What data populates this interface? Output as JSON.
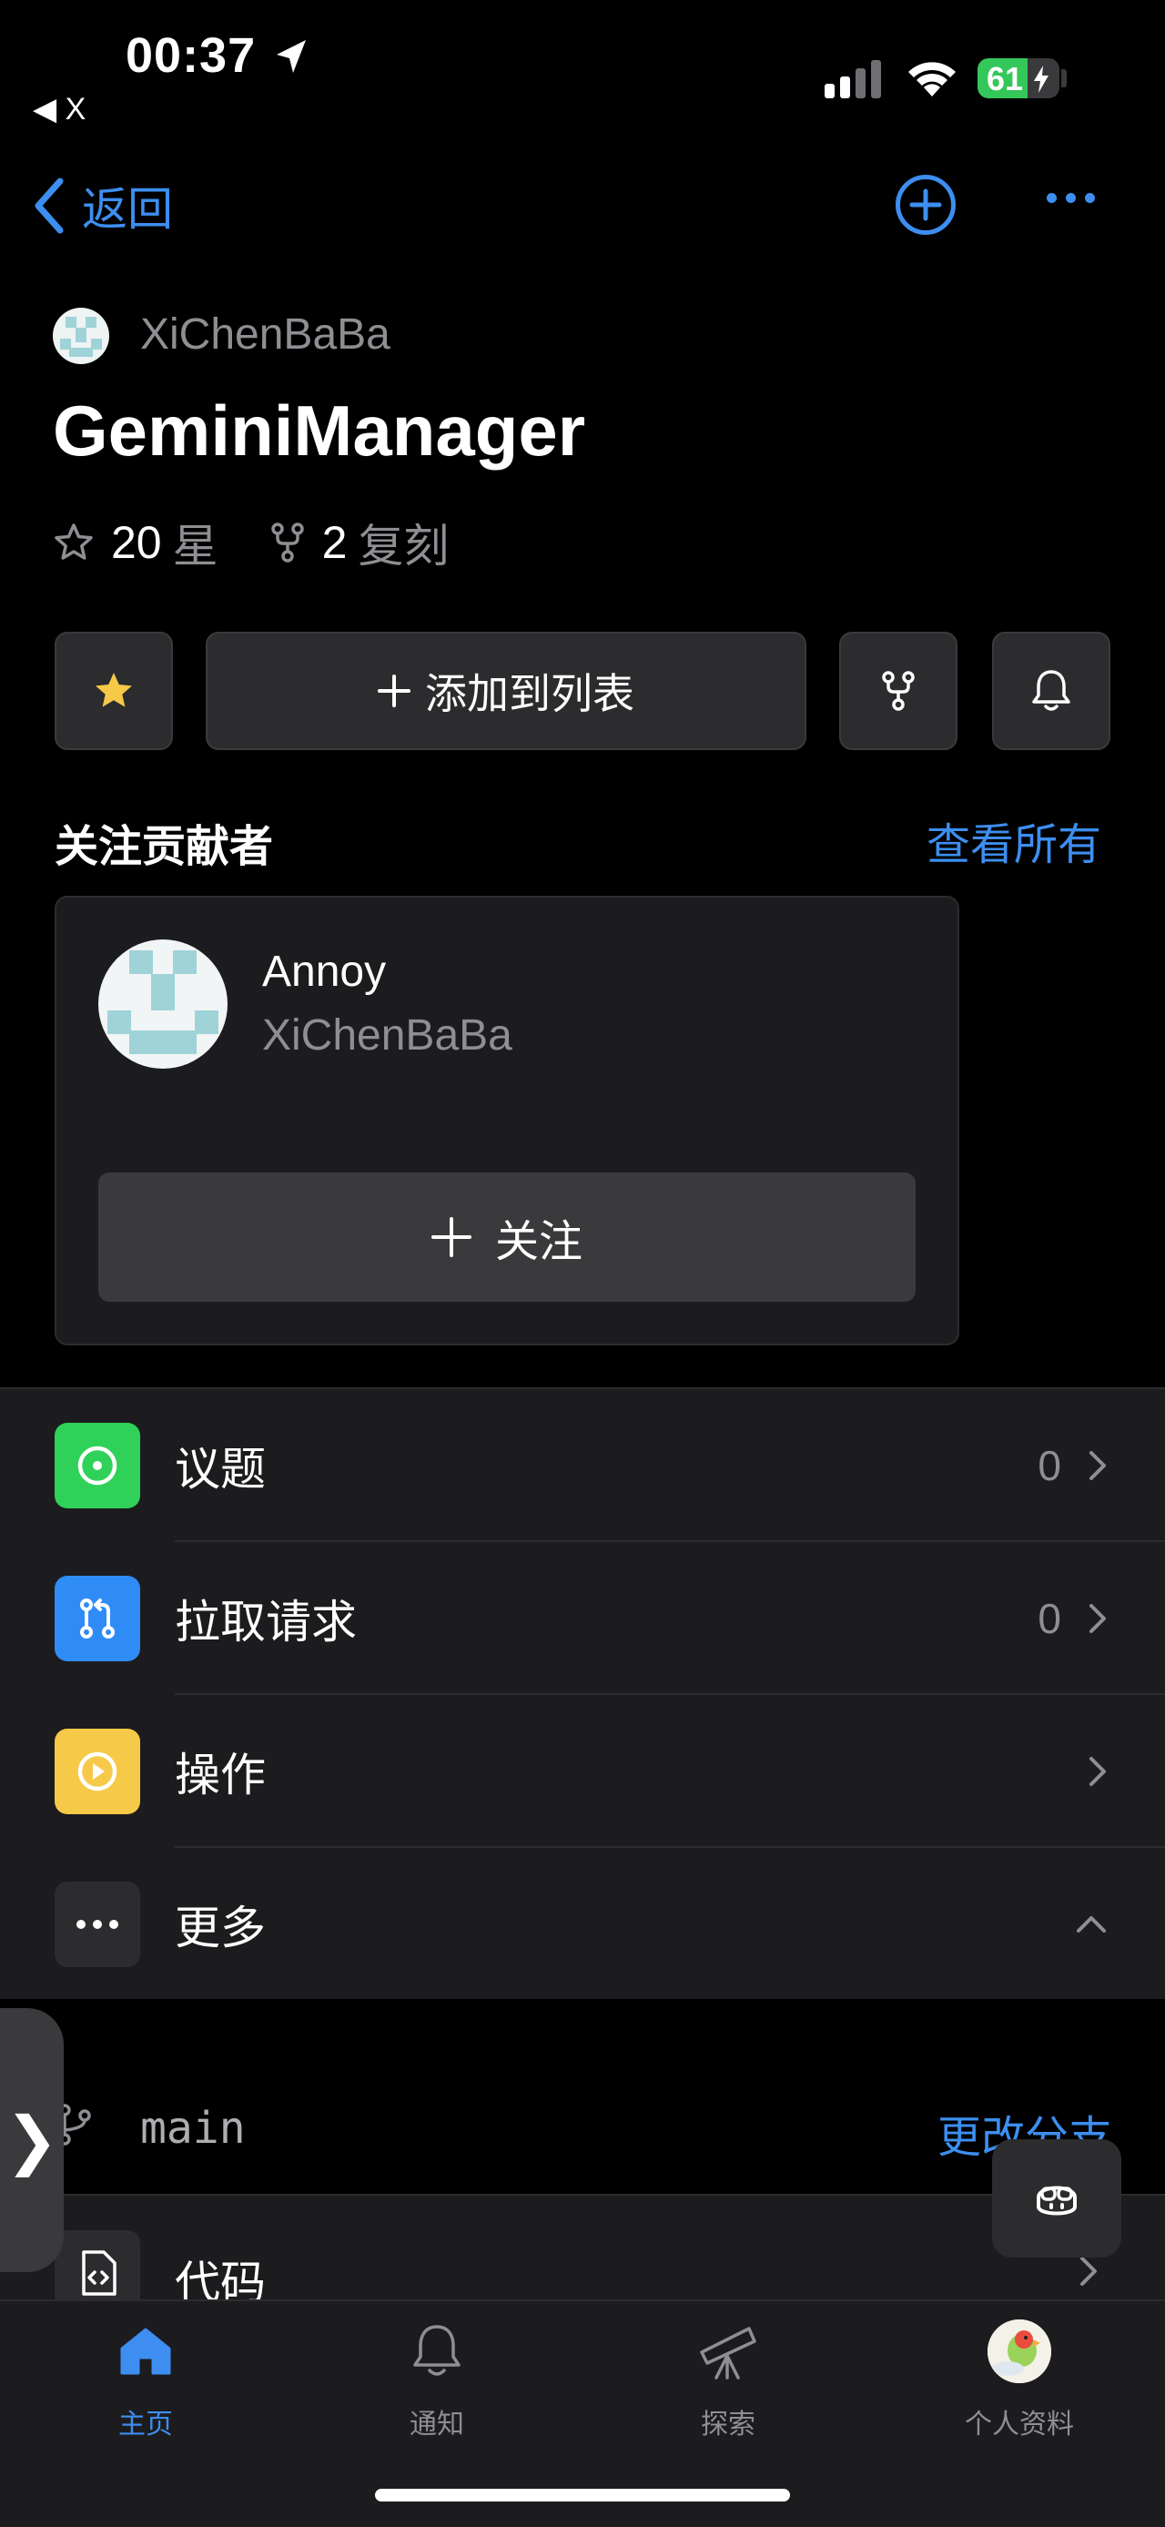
{
  "status_bar": {
    "time": "00:37",
    "back_app": "◀ X",
    "battery": {
      "level": 61,
      "label": "61"
    }
  },
  "nav": {
    "back_label": "返回"
  },
  "repo": {
    "owner": "XiChenBaBa",
    "name": "GeminiManager",
    "stars": {
      "count": "20",
      "label": "星"
    },
    "forks": {
      "count": "2",
      "label": "复刻"
    }
  },
  "actions": {
    "add_to_list": "添加到列表"
  },
  "contributors": {
    "title": "关注贡献者",
    "view_all": "查看所有",
    "card": {
      "name": "Annoy",
      "login": "XiChenBaBa",
      "follow_label": "关注"
    }
  },
  "menu": [
    {
      "label": "议题",
      "count": "0",
      "color": "#30d158"
    },
    {
      "label": "拉取请求",
      "count": "0",
      "color": "#2f8cf6"
    },
    {
      "label": "操作",
      "count": "",
      "color": "#f7c948"
    },
    {
      "label": "更多",
      "count": "",
      "color": "#2c2c2e"
    }
  ],
  "branch": {
    "name": "main",
    "change_label": "更改分支"
  },
  "code_row": {
    "label": "代码"
  },
  "side_handle": {
    "glyph": "❯"
  },
  "tabs": [
    {
      "label": "主页",
      "active": true
    },
    {
      "label": "通知",
      "active": false
    },
    {
      "label": "探索",
      "active": false
    },
    {
      "label": "个人资料",
      "active": false
    }
  ],
  "colors": {
    "accent": "#3d8ef0",
    "background": "#000000",
    "surface": "#1c1c1e",
    "star": "#f7c948"
  }
}
